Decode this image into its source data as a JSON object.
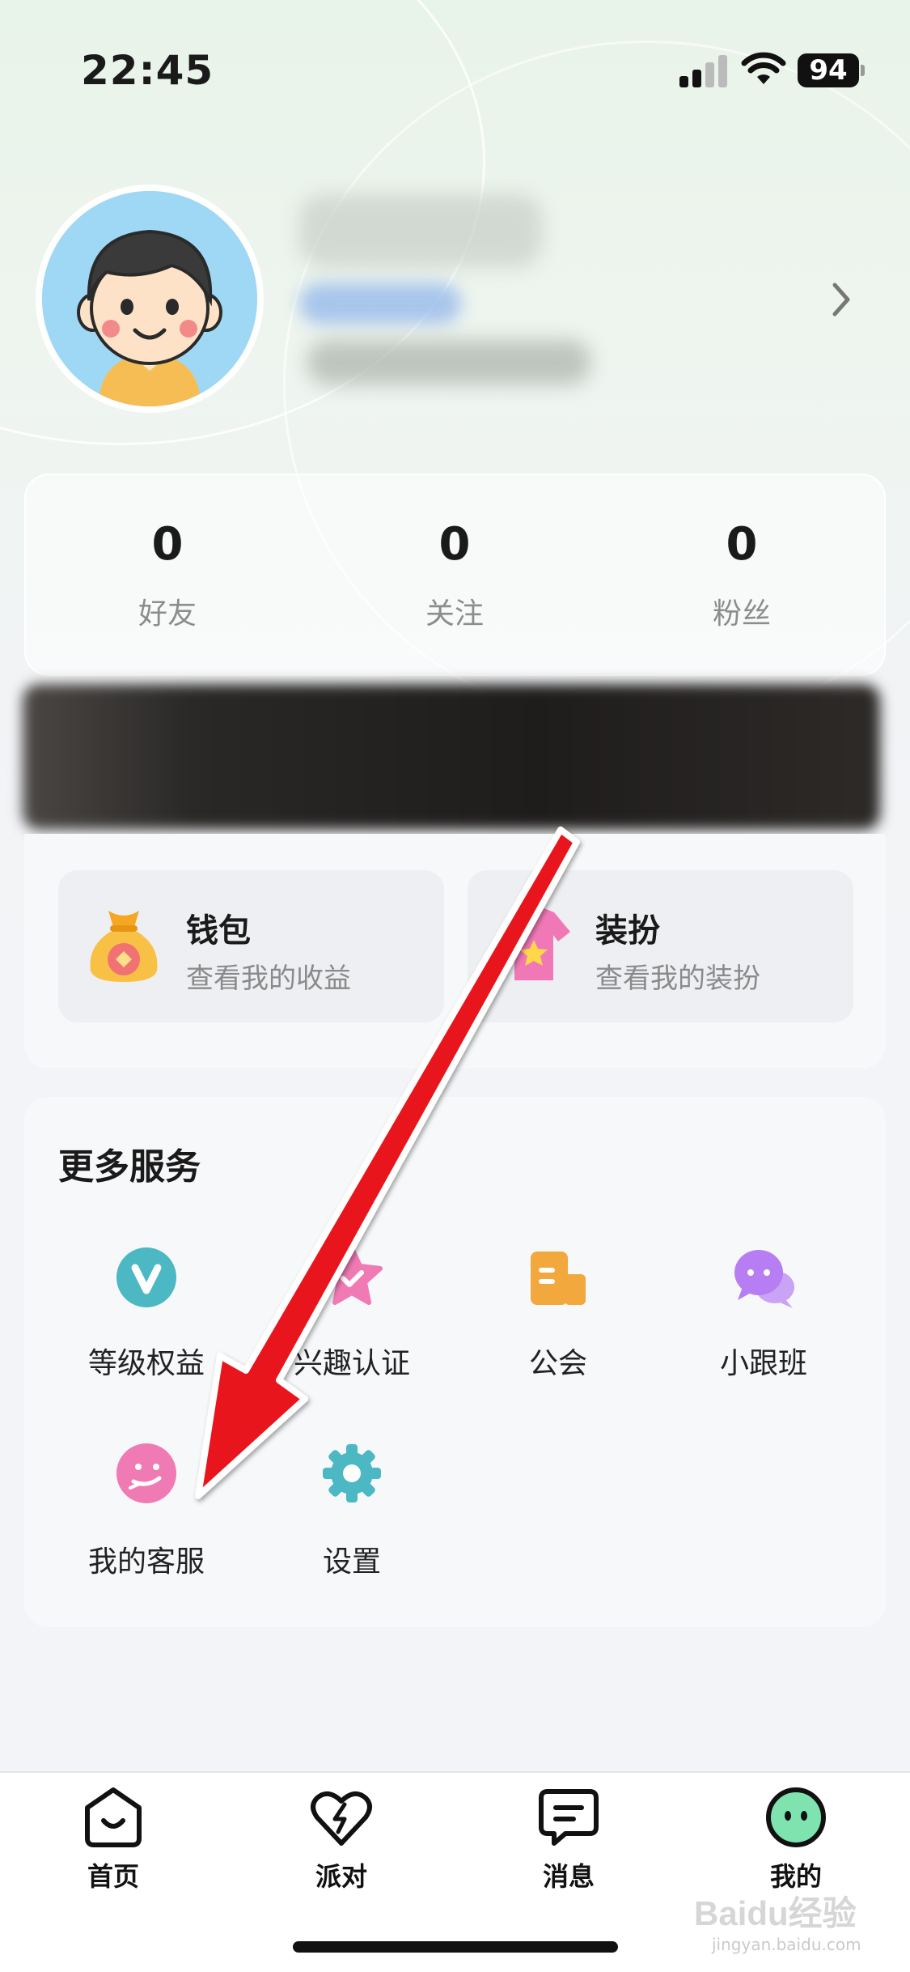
{
  "status_bar": {
    "time": "22:45",
    "battery": "94"
  },
  "stats": [
    {
      "value": "0",
      "label": "好友"
    },
    {
      "value": "0",
      "label": "关注"
    },
    {
      "value": "0",
      "label": "粉丝"
    }
  ],
  "quick_tiles": [
    {
      "title": "钱包",
      "subtitle": "查看我的收益",
      "icon": "money-bag-icon"
    },
    {
      "title": "装扮",
      "subtitle": "查看我的装扮",
      "icon": "outfit-icon"
    }
  ],
  "more_services": {
    "title": "更多服务",
    "items": [
      {
        "label": "等级权益",
        "icon": "v-level-icon",
        "color": "#4bb8c4"
      },
      {
        "label": "兴趣认证",
        "icon": "star-badge-icon",
        "color": "#f07ab4"
      },
      {
        "label": "公会",
        "icon": "building-icon",
        "color": "#f2a83c"
      },
      {
        "label": "小跟班",
        "icon": "chat-bubbles-icon",
        "color": "#b67ef2"
      },
      {
        "label": "我的客服",
        "icon": "support-face-icon",
        "color": "#f07ab4"
      },
      {
        "label": "设置",
        "icon": "gear-icon",
        "color": "#4bb8c4"
      }
    ]
  },
  "bottom_nav": [
    {
      "label": "首页",
      "icon": "home-icon"
    },
    {
      "label": "派对",
      "icon": "heart-bolt-icon"
    },
    {
      "label": "消息",
      "icon": "message-icon"
    },
    {
      "label": "我的",
      "icon": "me-face-icon",
      "active": true
    }
  ],
  "watermark": {
    "brand": "Baidu经验",
    "url": "jingyan.baidu.com"
  },
  "colors": {
    "accent_green": "#7fe3b0",
    "annotation_red": "#e8151b"
  }
}
